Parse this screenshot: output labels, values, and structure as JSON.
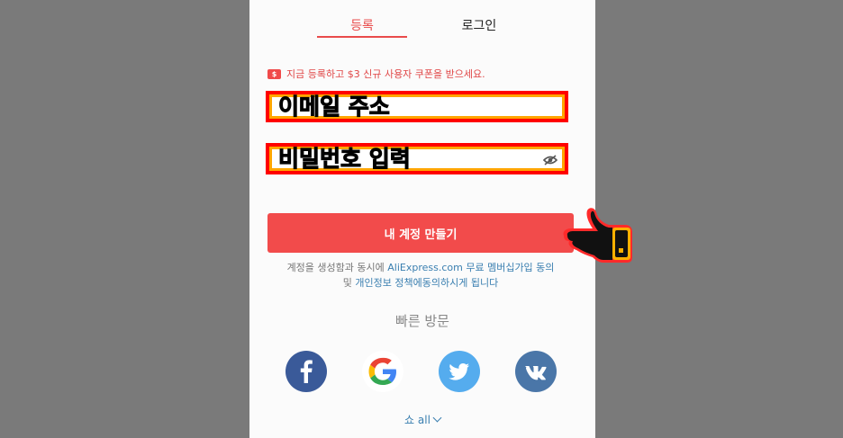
{
  "tabs": {
    "register": "등록",
    "login": "로그인"
  },
  "promo": {
    "text": "지금 등록하고 $3 신규 사용자 쿠폰을 받으세요.",
    "icon_label": "$"
  },
  "form": {
    "email_placeholder": "이메일 주소",
    "password_placeholder": "비밀번호 입력",
    "submit_label": "내 계정 만들기"
  },
  "terms": {
    "prefix": "계정을 생성함과 동시에 ",
    "link1": "AliExpress.com 무료 멤버십가입 동의",
    "middle": "및 ",
    "link2": "개인정보 정책에동의하시게 됩니다",
    "suffix": ""
  },
  "quick": {
    "title": "빠른 방문",
    "show_all": "쇼 all"
  },
  "colors": {
    "accent": "#f24b4b",
    "link": "#3a7fb0",
    "facebook": "#3a5a99",
    "twitter": "#55acee",
    "vk": "#4a76a8"
  },
  "icons": [
    "coupon-icon",
    "eye-off-icon",
    "pointing-hand-icon",
    "facebook-icon",
    "google-icon",
    "twitter-icon",
    "vk-icon",
    "chevron-down-icon"
  ]
}
